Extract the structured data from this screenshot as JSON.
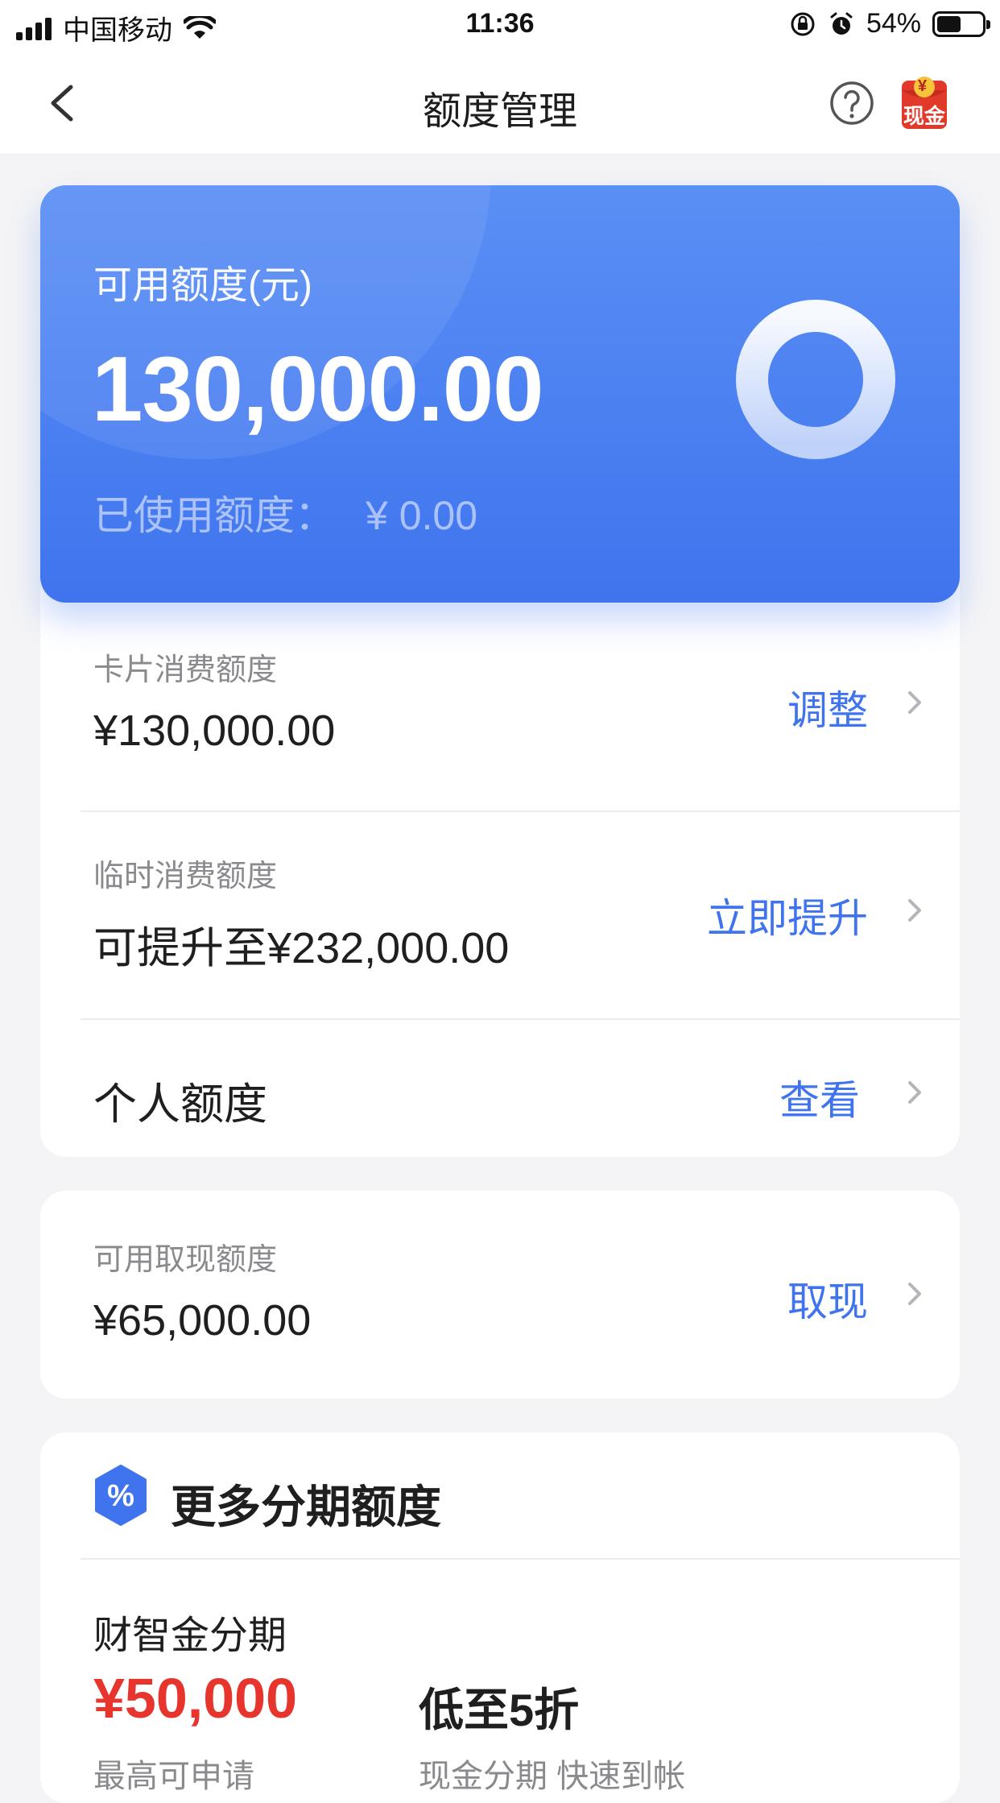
{
  "status_bar": {
    "carrier": "中国移动",
    "time": "11:36",
    "battery_percent": "54%"
  },
  "nav": {
    "title": "额度管理",
    "cash_badge_top": "¥",
    "cash_badge_label": "现金"
  },
  "hero": {
    "label": "可用额度(元)",
    "amount": "130,000.00",
    "used_label": "已使用额度：",
    "used_value": "¥ 0.00"
  },
  "limits": [
    {
      "sub": "卡片消费额度",
      "main": "¥130,000.00",
      "action": "调整"
    },
    {
      "sub": "临时消费额度",
      "main": "可提升至¥232,000.00",
      "action": "立即提升"
    },
    {
      "main": "个人额度",
      "action": "查看"
    }
  ],
  "cash": {
    "sub": "可用取现额度",
    "main": "¥65,000.00",
    "action": "取现"
  },
  "more": {
    "icon_symbol": "%",
    "title": "更多分期额度",
    "product_name": "财智金分期",
    "product_amount": "¥50,000",
    "product_amount_sub": "最高可申请",
    "product_rate": "低至5折",
    "product_rate_sub": "现金分期  快速到帐"
  },
  "colors": {
    "accent": "#3f74ee",
    "highlight_red": "#e7352e"
  }
}
